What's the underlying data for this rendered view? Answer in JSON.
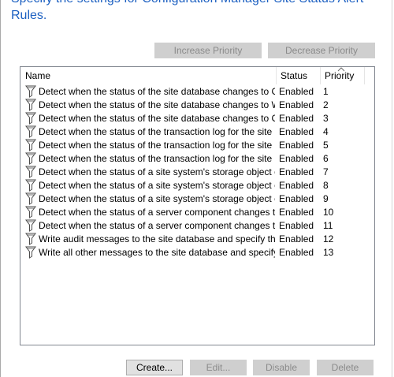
{
  "heading": {
    "line1": "Specify the settings for Configuration Manager Site Status Alert",
    "line2": "Rules."
  },
  "top_buttons": {
    "increase": "Increase Priority",
    "decrease": "Decrease Priority"
  },
  "columns": {
    "name": "Name",
    "status": "Status",
    "priority": "Priority"
  },
  "rows": [
    {
      "name": "Detect when the status of the site database changes to Critic...",
      "status": "Enabled",
      "priority": "1"
    },
    {
      "name": "Detect when the status of the site database changes to War...",
      "status": "Enabled",
      "priority": "2"
    },
    {
      "name": "Detect when the status of the site database changes to Critic...",
      "status": "Enabled",
      "priority": "3"
    },
    {
      "name": "Detect when the status of the transaction log for the site data...",
      "status": "Enabled",
      "priority": "4"
    },
    {
      "name": "Detect when the status of the transaction log for the site data...",
      "status": "Enabled",
      "priority": "5"
    },
    {
      "name": "Detect when the status of the transaction log for the site data...",
      "status": "Enabled",
      "priority": "6"
    },
    {
      "name": "Detect when the status of a site system's storage object cha...",
      "status": "Enabled",
      "priority": "7"
    },
    {
      "name": "Detect when the status of a site system's storage object cha...",
      "status": "Enabled",
      "priority": "8"
    },
    {
      "name": "Detect when the status of a site system's storage object cha...",
      "status": "Enabled",
      "priority": "9"
    },
    {
      "name": "Detect when the status of a server component changes to ...",
      "status": "Enabled",
      "priority": "10"
    },
    {
      "name": "Detect when the status of a server component changes to Cr...",
      "status": "Enabled",
      "priority": "11"
    },
    {
      "name": "Write audit messages to the site database and specify the pe...",
      "status": "Enabled",
      "priority": "12"
    },
    {
      "name": "Write all other messages to the site database and specify the...",
      "status": "Enabled",
      "priority": "13"
    }
  ],
  "bottom_buttons": {
    "create": "Create...",
    "edit": "Edit...",
    "disable": "Disable",
    "delete": "Delete"
  },
  "icons": {
    "rule": "rule-funnel-icon",
    "sort": "sort-ascending-icon"
  },
  "colors": {
    "heading": "#1b5fc1",
    "disabled_button": "#cfcfcf",
    "list_border": "#828790"
  }
}
